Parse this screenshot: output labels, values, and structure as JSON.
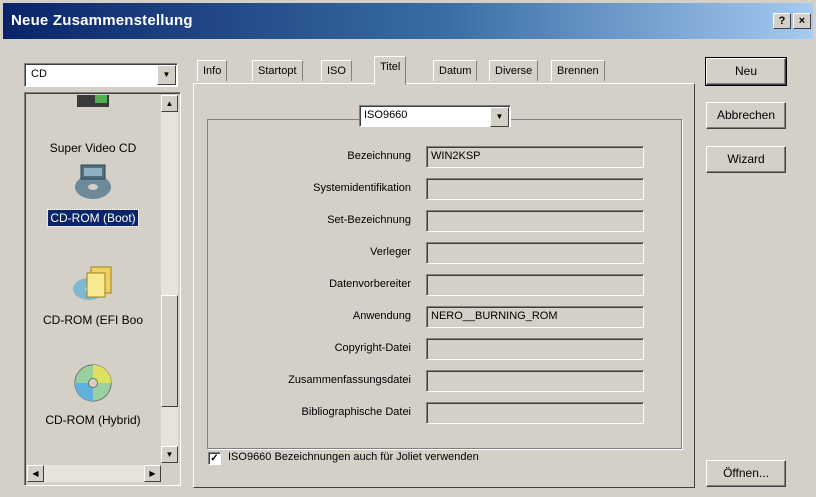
{
  "window": {
    "title": "Neue Zusammenstellung",
    "help_glyph": "?",
    "close_glyph": "×"
  },
  "media_combo": {
    "value": "CD"
  },
  "project_list": {
    "items": [
      {
        "label": "Super Video CD",
        "icon": "super-video-cd-icon",
        "selected": false
      },
      {
        "label": "CD-ROM (Boot)",
        "icon": "cd-rom-boot-icon",
        "selected": true
      },
      {
        "label": "CD-ROM (EFI Boo",
        "icon": "cd-rom-efi-boot-icon",
        "selected": false
      },
      {
        "label": "CD-ROM (Hybrid)",
        "icon": "cd-rom-hybrid-icon",
        "selected": false
      }
    ]
  },
  "tabs": [
    {
      "label": "Info",
      "active": false
    },
    {
      "label": "Startopt",
      "active": false
    },
    {
      "label": "ISO",
      "active": false
    },
    {
      "label": "Titel",
      "active": true
    },
    {
      "label": "Datum",
      "active": false
    },
    {
      "label": "Diverse",
      "active": false
    },
    {
      "label": "Brennen",
      "active": false
    }
  ],
  "filesystem_combo": {
    "value": "ISO9660"
  },
  "fields": [
    {
      "label": "Bezeichnung",
      "value": "WIN2KSP"
    },
    {
      "label": "Systemidentifikation",
      "value": ""
    },
    {
      "label": "Set-Bezeichnung",
      "value": ""
    },
    {
      "label": "Verleger",
      "value": ""
    },
    {
      "label": "Datenvorbereiter",
      "value": ""
    },
    {
      "label": "Anwendung",
      "value": "NERO__BURNING_ROM"
    },
    {
      "label": "Copyright-Datei",
      "value": ""
    },
    {
      "label": "Zusammenfassungsdatei",
      "value": ""
    },
    {
      "label": "Bibliographische Datei",
      "value": ""
    }
  ],
  "joliet_checkbox": {
    "checked": true,
    "mark": "✓",
    "label": "ISO9660 Bezeichnungen auch für Joliet verwenden"
  },
  "buttons": {
    "new": "Neu",
    "cancel": "Abbrechen",
    "wizard": "Wizard",
    "open": "Öffnen..."
  },
  "colors": {
    "selection": "#0a246a",
    "face": "#d4d0c8"
  }
}
